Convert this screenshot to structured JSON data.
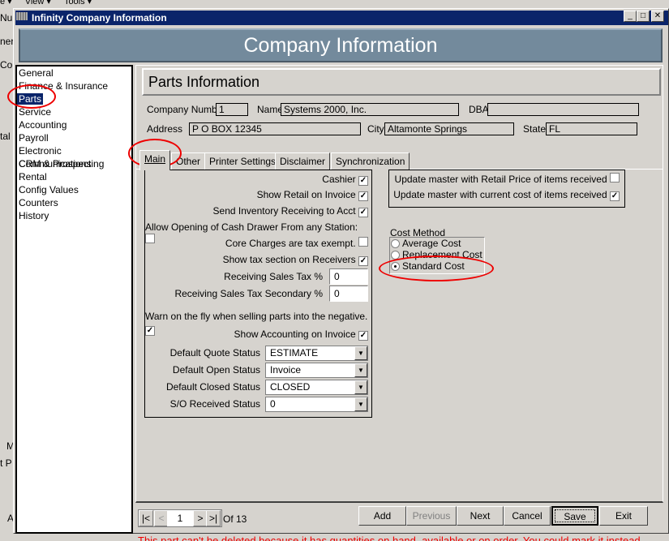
{
  "background_app": {
    "menu": [
      "e ▾",
      "View ▾",
      "Tools ▾"
    ],
    "fragments": [
      "Nu",
      "ner",
      "Co",
      "tal",
      "M",
      "t P",
      "A"
    ],
    "status_message": "This part can't be deleted because it has quantities on hand, available or on order. You could mark it instead."
  },
  "window": {
    "title": "Infinity Company Information",
    "minimize": "_",
    "maximize": "□",
    "close": "✕"
  },
  "header": {
    "title": "Company Information"
  },
  "sidebar": {
    "items": [
      {
        "label": "General"
      },
      {
        "label": "Finance & Insurance"
      },
      {
        "label": "Parts",
        "selected": true
      },
      {
        "label": "Service"
      },
      {
        "label": "Accounting"
      },
      {
        "label": "Payroll"
      },
      {
        "label": "Electronic Communications"
      },
      {
        "label": "CRM & Prospecting"
      },
      {
        "label": "Rental"
      },
      {
        "label": "Config Values"
      },
      {
        "label": "Counters"
      },
      {
        "label": "History"
      }
    ]
  },
  "section_title": "Parts Information",
  "company": {
    "number_label": "Company Number",
    "number": "1",
    "name_label": "Name",
    "name": "Systems 2000, Inc.",
    "dba_label": "DBA",
    "dba": "",
    "address_label": "Address",
    "address": "P O BOX 12345",
    "city_label": "City",
    "city": "Altamonte Springs",
    "state_label": "State",
    "state": "FL"
  },
  "tabs": [
    {
      "label": "Main",
      "active": true
    },
    {
      "label": "Other"
    },
    {
      "label": "Printer Settings"
    },
    {
      "label": "Disclaimer"
    },
    {
      "label": "Synchronization"
    }
  ],
  "main": {
    "checkboxes": [
      {
        "label": "Cashier",
        "checked": true
      },
      {
        "label": "Show Retail on Invoice",
        "checked": true
      },
      {
        "label": "Send Inventory Receiving to Acct",
        "checked": true
      },
      {
        "label": "Allow Opening of Cash Drawer From any Station:",
        "checked": false
      },
      {
        "label": "Core Charges are tax exempt.",
        "checked": false
      },
      {
        "label": "Show tax section on Receivers",
        "checked": true
      }
    ],
    "tax": [
      {
        "label": "Receiving Sales Tax %",
        "value": "0"
      },
      {
        "label": "Receiving Sales Tax Secondary %",
        "value": "0"
      }
    ],
    "checkboxes2": [
      {
        "label": "Warn on the fly when selling parts into the negative.",
        "checked": true
      },
      {
        "label": "Show Accounting on Invoice",
        "checked": true
      }
    ],
    "statuses": [
      {
        "label": "Default Quote Status",
        "value": "ESTIMATE"
      },
      {
        "label": "Default Open Status",
        "value": "Invoice"
      },
      {
        "label": "Default Closed Status",
        "value": "CLOSED"
      },
      {
        "label": "S/O Received Status",
        "value": "0"
      }
    ],
    "update": [
      {
        "label": "Update master with Retail Price of items received",
        "checked": false
      },
      {
        "label": "Update master with current cost of items received",
        "checked": true
      }
    ],
    "cost_method": {
      "label": "Cost Method",
      "options": [
        "Average Cost",
        "Replacement Cost",
        "Standard Cost"
      ],
      "selected": "Standard Cost"
    }
  },
  "navigator": {
    "first": "|<",
    "prev": "<",
    "page": "1",
    "next": ">",
    "last": ">|",
    "total": "Of 13"
  },
  "buttons": {
    "add": "Add",
    "previous": "Previous",
    "next": "Next",
    "cancel": "Cancel",
    "save": "Save",
    "exit": "Exit"
  },
  "annotation_color": "#e00000"
}
